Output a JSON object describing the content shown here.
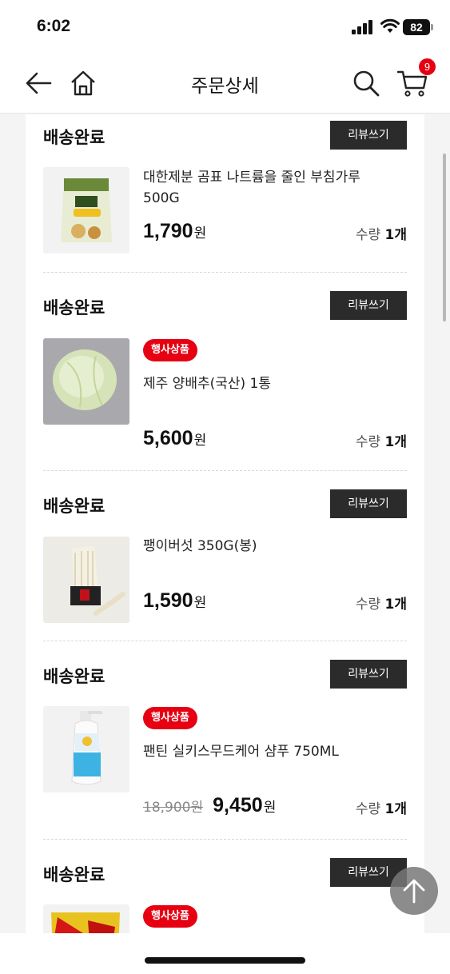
{
  "status_bar": {
    "time": "6:02",
    "battery": "82"
  },
  "header": {
    "title": "주문상세",
    "cart_count": "9"
  },
  "orders": [
    {
      "status": "배송완료",
      "review_label": "리뷰쓰기",
      "name": "대한제분 곰표 나트륨을 줄인 부침가루 500G",
      "price": "1,790",
      "won": "원",
      "qty_label": "수량",
      "qty": "1개"
    },
    {
      "status": "배송완료",
      "review_label": "리뷰쓰기",
      "badge": "행사상품",
      "name": "제주 양배추(국산) 1통",
      "price": "5,600",
      "won": "원",
      "qty_label": "수량",
      "qty": "1개"
    },
    {
      "status": "배송완료",
      "review_label": "리뷰쓰기",
      "name": "팽이버섯 350G(봉)",
      "price": "1,590",
      "won": "원",
      "qty_label": "수량",
      "qty": "1개"
    },
    {
      "status": "배송완료",
      "review_label": "리뷰쓰기",
      "badge": "행사상품",
      "name": "팬틴 실키스무드케어 샴푸 750ML",
      "original_price": "18,900원",
      "price": "9,450",
      "won": "원",
      "qty_label": "수량",
      "qty": "1개"
    },
    {
      "status": "배송완료",
      "review_label": "리뷰쓰기",
      "badge": "행사상품"
    }
  ],
  "icons": [
    "back-arrow-icon",
    "home-icon",
    "search-icon",
    "cart-icon",
    "arrow-up-icon"
  ]
}
